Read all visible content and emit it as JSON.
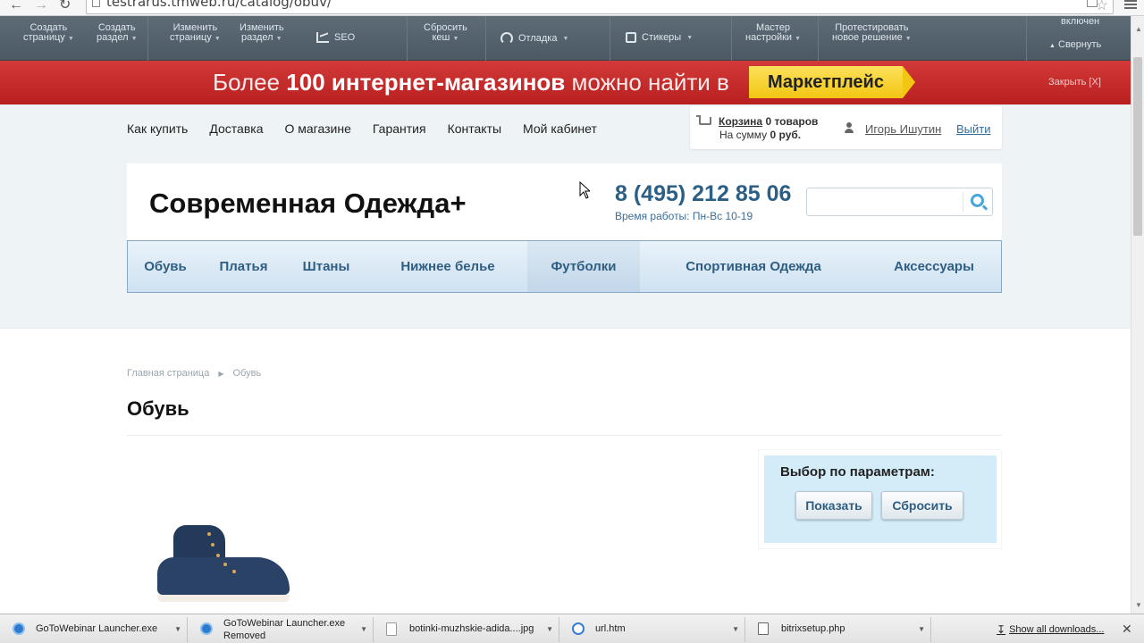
{
  "browser": {
    "url": "testrarus.tmweb.ru/catalog/obuv/"
  },
  "admin_panel": {
    "items": [
      {
        "line1": "Создать",
        "line2": "страницу"
      },
      {
        "line1": "Создать",
        "line2": "раздел"
      },
      {
        "line1": "Изменить",
        "line2": "страницу"
      },
      {
        "line1": "Изменить",
        "line2": "раздел"
      },
      {
        "line1": "Сбросить",
        "line2": "кеш"
      },
      {
        "line1": "Мастер",
        "line2": "настройки"
      },
      {
        "line1": "Протестировать",
        "line2": "новое решение"
      }
    ],
    "seo_label": "SEO",
    "debug_label": "Отладка",
    "stickers_label": "Стикеры",
    "enabled_label": "включен",
    "collapse_label": "Свернуть"
  },
  "banner": {
    "text_prefix": "Более",
    "text_bold": "100 интернет-магазинов",
    "text_suffix": "можно найти в",
    "button_label": "Маркетплейс",
    "close_label": "Закрыть [X]"
  },
  "top_links": [
    "Как купить",
    "Доставка",
    "О магазине",
    "Гарантия",
    "Контакты",
    "Мой кабинет"
  ],
  "cart": {
    "link_label": "Корзина",
    "count_text": "0 товаров",
    "sum_prefix": "На сумму",
    "sum_value": "0 руб."
  },
  "user": {
    "name": "Игорь Ишутин",
    "logout_label": "Выйти"
  },
  "header": {
    "site_title": "Современная Одежда+",
    "phone": "8 (495) 212 85 06",
    "worktime": "Время работы: Пн-Вс 10-19",
    "search_placeholder": ""
  },
  "main_nav": [
    {
      "label": "Обувь"
    },
    {
      "label": "Платья"
    },
    {
      "label": "Штаны"
    },
    {
      "label": "Нижнее белье"
    },
    {
      "label": "Футболки"
    },
    {
      "label": "Спортивная Одежда"
    },
    {
      "label": "Аксессуары"
    }
  ],
  "breadcrumb": {
    "home": "Главная страница",
    "current": "Обувь"
  },
  "page_title": "Обувь",
  "filter": {
    "title": "Выбор по параметрам:",
    "show_label": "Показать",
    "reset_label": "Сбросить"
  },
  "downloads": {
    "items": [
      {
        "name": "GoToWebinar Launcher.exe",
        "status": ""
      },
      {
        "name": "GoToWebinar Launcher.exe",
        "status": "Removed"
      },
      {
        "name": "botinki-muzhskie-adida....jpg",
        "status": ""
      },
      {
        "name": "url.htm",
        "status": ""
      },
      {
        "name": "bitrixsetup.php",
        "status": ""
      }
    ],
    "show_all_label": "Show all downloads..."
  },
  "colors": {
    "accent_blue": "#2f5e82",
    "banner_red": "#c62d2d",
    "banner_button": "#f3c614",
    "filter_bg": "#d3ecf8"
  }
}
